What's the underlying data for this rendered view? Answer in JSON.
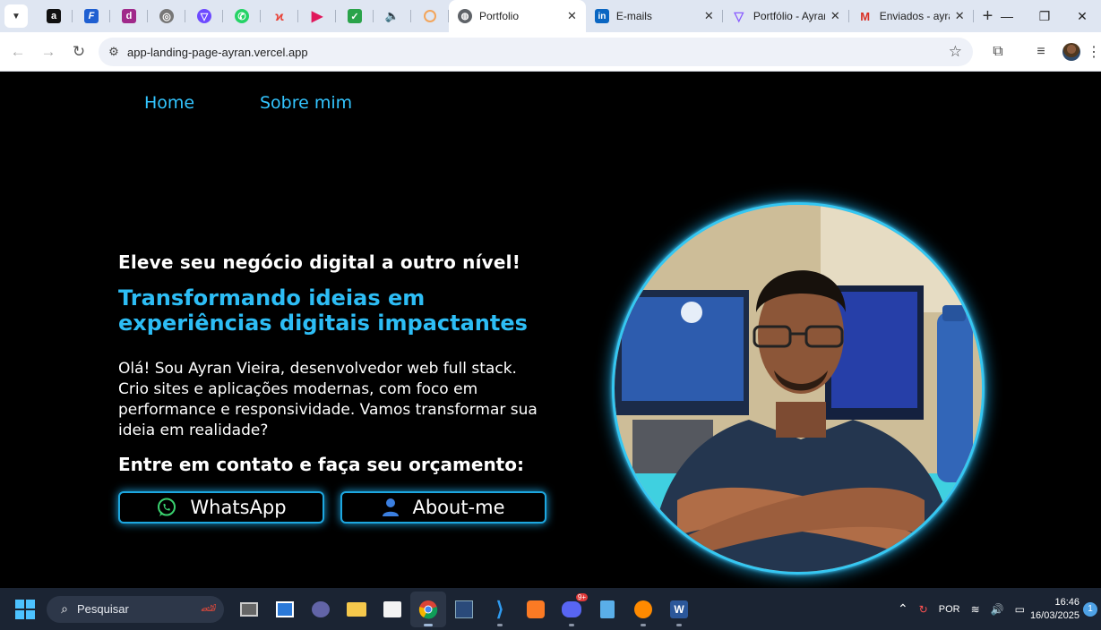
{
  "browser": {
    "tabs": [
      {
        "title": "Portfolio",
        "active": true
      },
      {
        "title": "E-mails",
        "active": false
      },
      {
        "title": "Portfólio - Ayran",
        "active": false
      },
      {
        "title": "Enviados - ayran",
        "active": false
      }
    ],
    "url": "app-landing-page-ayran.vercel.app"
  },
  "page": {
    "nav": {
      "home": "Home",
      "about": "Sobre mim"
    },
    "headline": "Eleve seu negócio digital a outro nível!",
    "subhead": "Transformando ideias em experiências digitais impactantes",
    "intro": "Olá! Sou Ayran Vieira, desenvolvedor web full stack. Crio sites e aplicações modernas, com foco em performance e responsividade. Vamos transformar sua ideia em realidade?",
    "cta": "Entre em contato e faça seu orçamento:",
    "buttons": {
      "whatsapp": "WhatsApp",
      "about": "About-me"
    },
    "accent_color": "#33c5ff"
  },
  "taskbar": {
    "search_placeholder": "Pesquisar",
    "language": "POR",
    "time": "16:46",
    "date": "16/03/2025",
    "notifications": "1",
    "discord_badge": "9+"
  }
}
